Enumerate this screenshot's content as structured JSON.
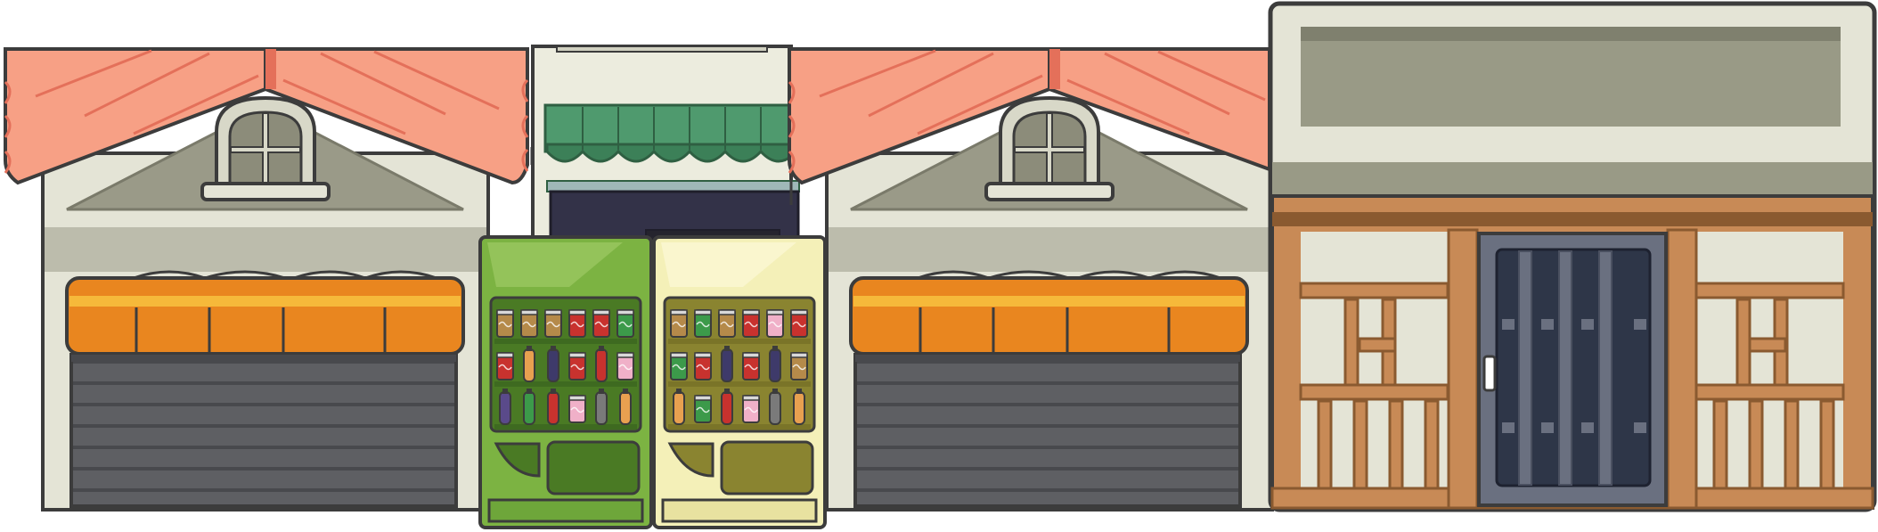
{
  "scene": {
    "title": "",
    "description_visible_text": []
  },
  "colors": {
    "outline": "#3c3c3c",
    "roof_light": "#f7a085",
    "roof_dark": "#e4705a",
    "wall_cream": "#e4e4d6",
    "wall_gray": "#bcbcac",
    "gable_gray": "#9a9a88",
    "awning_orange": "#e9861f",
    "awning_yellow": "#f6b93a",
    "shutter_dark": "#5e5f63",
    "shutter_line": "#48494d",
    "machine_green": "#7cb342",
    "machine_green_dark": "#4a7a24",
    "machine_cream": "#f4f0b8",
    "machine_cream_dark": "#8a8430",
    "canopy_green": "#4f9a6e",
    "wood": "#c88a56",
    "wood_dark": "#8a5a30",
    "door_steel": "#6a7080",
    "door_glass": "#2e3648",
    "sign_panel": "#999a86"
  },
  "buildings": [
    {
      "kind": "garage-shop",
      "roof": "tiled-red",
      "awning": "orange",
      "shutter": "closed"
    },
    {
      "kind": "narrow-shop",
      "canopy": "green-scalloped"
    },
    {
      "kind": "garage-shop",
      "roof": "tiled-red",
      "awning": "orange",
      "shutter": "closed"
    },
    {
      "kind": "wooden-storefront",
      "door": "steel-barred",
      "sign": "blank"
    }
  ],
  "vending_machines": [
    {
      "name": "green-machine",
      "body": "#7cb342",
      "rows": [
        [
          "#b58a4a",
          "#b58a4a",
          "#b58a4a",
          "#c8322e",
          "#c8322e",
          "#3c9a4a"
        ],
        [
          "#c8322e",
          "#e8a050",
          "#3e3a6a",
          "#c8322e",
          "#c8322e",
          "#f0b0c8"
        ],
        [
          "#5a4a8a",
          "#3c9a4a",
          "#c8322e",
          "#f0b0c8",
          "#7a7a7a",
          "#e8a050"
        ]
      ]
    },
    {
      "name": "cream-machine",
      "body": "#f4f0b8",
      "rows": [
        [
          "#b58a4a",
          "#3c9a4a",
          "#b58a4a",
          "#c8322e",
          "#f0b0c8",
          "#c8322e"
        ],
        [
          "#3c9a4a",
          "#c8322e",
          "#3e3a6a",
          "#c8322e",
          "#3e3a6a",
          "#b58a4a"
        ],
        [
          "#e8a050",
          "#3c9a4a",
          "#c8322e",
          "#f0b0c8",
          "#7a7a7a",
          "#e8a050"
        ]
      ]
    }
  ]
}
